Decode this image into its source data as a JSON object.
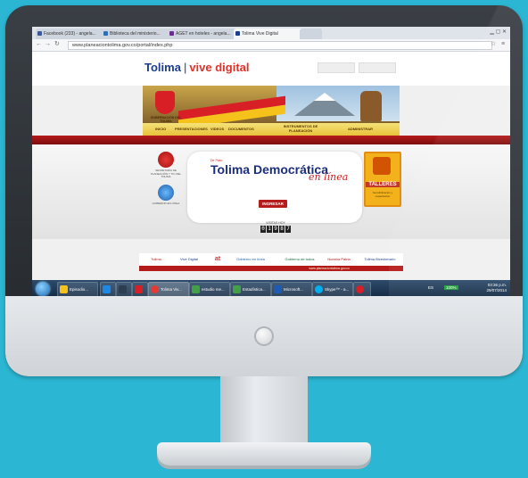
{
  "browser": {
    "tabs": [
      {
        "label": "Facebook (233) - angela...",
        "color": "#3b5998"
      },
      {
        "label": "Biblioteca del ministerio...",
        "color": "#2c6fb7"
      },
      {
        "label": "AGET en hoteles - angela...",
        "color": "#6a2c91"
      },
      {
        "label": "Tolima Vive Digital",
        "color": "#1a3d8f"
      }
    ],
    "url": "www.planeaciontolima.gov.co/portal/index.php"
  },
  "header": {
    "title_main": "Tolima",
    "title_sub": "vive digital"
  },
  "banner": {
    "gov_label": "GOBERNACIÓN DEL TOLIMA",
    "menu": [
      "INICIO",
      "PRESENTACIONES",
      "VIDEOS",
      "DOCUMENTOS",
      "INSTRUMENTOS DE PLANEACIÓN",
      "ADMINISTRAR"
    ]
  },
  "content": {
    "left_caption_1": "SECRETARÍA DE PLANEACIÓN Y TIC DEL TOLIMA",
    "left_caption_2": "GOBIERNO EN LÍNEA",
    "de_paso": "De Paso",
    "demo_title": "Tolima Democrática",
    "demo_tagline": "en línea",
    "ingresar": "INGRESAR",
    "talleres": "TALLERES",
    "talleres_sub": "Sensibilización y capacitación",
    "counter_label": "VISITAS HOY",
    "counter_digits": [
      "0",
      "1",
      "9",
      "8",
      "7"
    ]
  },
  "footer": {
    "logos": [
      "Tolima",
      "Vive Digital",
      "at",
      "Gobierno en línea",
      "Gobierno de todos",
      "Nuestra Patria",
      "Tolima Bicentenario"
    ],
    "url": "www.planeaciontolima.gov.co"
  },
  "taskbar": {
    "items": [
      {
        "label": "Episodio...",
        "color": "#f4c21a"
      },
      {
        "label": "",
        "color": "#1e88e5"
      },
      {
        "label": "",
        "color": "#2d3e50"
      },
      {
        "label": "",
        "color": "#d81f26"
      },
      {
        "label": "Tolima Viv...",
        "color": "#e53935"
      },
      {
        "label": "estudio me...",
        "color": "#43a047"
      },
      {
        "label": "Estadística...",
        "color": "#43a047"
      },
      {
        "label": "Microsoft...",
        "color": "#1e5bb4"
      },
      {
        "label": "Skype™ - a...",
        "color": "#00aff0"
      },
      {
        "label": "",
        "color": "#d81f26"
      }
    ],
    "lang": "ES",
    "battery": "100%",
    "time": "03:36 p.m.",
    "date": "29/07/2014"
  }
}
